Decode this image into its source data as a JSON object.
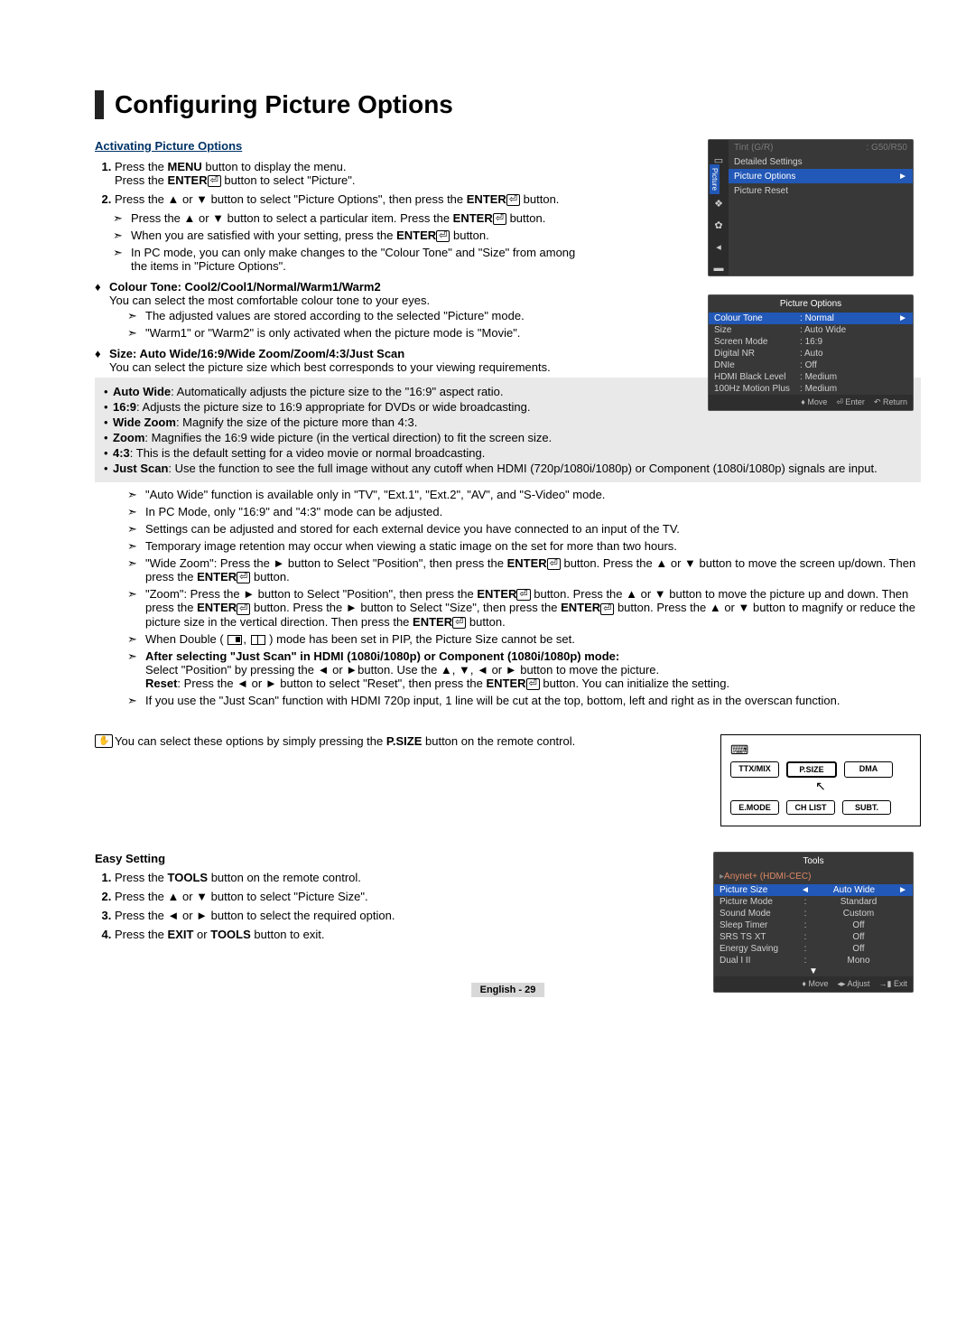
{
  "title": "Configuring Picture Options",
  "headings": {
    "activating": "Activating Picture Options",
    "easy": "Easy Setting"
  },
  "steps": {
    "s1a": "Press the ",
    "s1a_bold": "MENU",
    "s1a_cont": " button to display the menu.",
    "s1b": "Press the ",
    "s1b_bold": "ENTER",
    "s1b_cont": " button to select \"Picture\".",
    "s2": "Press the ▲ or ▼ button to select \"Picture Options\", then press the ",
    "s2_bold": "ENTER",
    "s2_cont": " button."
  },
  "notes1": {
    "n1": "Press the ▲ or ▼ button to select a particular item. Press the ",
    "n1_bold": "ENTER",
    "n1_cont": " button.",
    "n2": "When you are satisfied with your setting, press the ",
    "n2_bold": "ENTER",
    "n2_cont": " button.",
    "n3": "In PC mode, you can only make changes to the \"Colour Tone\" and \"Size\" from among the items in \"Picture Options\"."
  },
  "colour": {
    "title": "Colour Tone: Cool2/Cool1/Normal/Warm1/Warm2",
    "desc": "You can select the most comfortable colour tone to your eyes.",
    "n1": "The adjusted values are stored according to the selected \"Picture\" mode.",
    "n2": "\"Warm1\" or \"Warm2\" is only activated when the picture mode is \"Movie\"."
  },
  "size": {
    "title": "Size: Auto Wide/16:9/Wide Zoom/Zoom/4:3/Just Scan",
    "desc": "You can select the picture size which best corresponds to your viewing requirements.",
    "bullets": {
      "b1_label": "Auto Wide",
      "b1": ": Automatically adjusts the picture size to the \"16:9\" aspect ratio.",
      "b2_label": "16:9",
      "b2": ": Adjusts the picture size to 16:9 appropriate for DVDs or wide broadcasting.",
      "b3_label": "Wide Zoom",
      "b3": ": Magnify the size of the picture more than 4:3.",
      "b4_label": "Zoom",
      "b4": ": Magnifies the 16:9 wide picture (in the vertical direction) to fit the screen size.",
      "b5_label": "4:3",
      "b5": ": This is the default setting for a video movie or normal broadcasting.",
      "b6_label": "Just Scan",
      "b6": ": Use the function to see the full image without any cutoff when HDMI (720p/1080i/1080p) or Component (1080i/1080p) signals are input."
    },
    "notes": {
      "m1": "\"Auto Wide\" function is available only in \"TV\", \"Ext.1\", \"Ext.2\", \"AV\", and \"S-Video\" mode.",
      "m2": "In PC Mode, only \"16:9\" and \"4:3\" mode can be adjusted.",
      "m3": "Settings can be adjusted and stored for each external device you have connected to an input of the TV.",
      "m4": "Temporary image retention may occur when viewing a static image on the set for more than two hours.",
      "m5a": "\"Wide Zoom\": Press the ► button to Select \"Position\", then press the ",
      "m5a_bold": "ENTER",
      "m5a_cont": " button. Press the ▲ or ▼ button to move the screen up/down. Then press the ",
      "m5b_bold": "ENTER",
      "m5b_cont": " button.",
      "m6a": "\"Zoom\": Press the ► button to Select \"Position\", then press the ",
      "m6a_bold": "ENTER",
      "m6a_cont": " button. Press the ▲ or ▼ button to move the picture up and down. Then press the ",
      "m6b_bold": "ENTER",
      "m6b_cont": " button. Press the ► button to Select \"Size\", then press the ",
      "m6c_bold": "ENTER",
      "m6c_cont": " button. Press the ▲ or ▼ button to magnify or reduce the picture size in the vertical direction. Then press the ",
      "m6d_bold": "ENTER",
      "m6d_cont": " button.",
      "m7a": "When Double ( ",
      "m7b": " ) mode has been set in PIP, the Picture Size cannot be set.",
      "m8_bold": "After selecting \"Just Scan\" in HDMI (1080i/1080p) or Component (1080i/1080p) mode:",
      "m8a": "Select \"Position\" by pressing the ◄ or ►button. Use the ▲, ▼, ◄ or ► button to move the picture.",
      "m8b_label": "Reset",
      "m8b": ": Press the ◄ or ► button to select \"Reset\", then press the ",
      "m8b_bold": "ENTER",
      "m8b_cont": " button. You can initialize the setting.",
      "m9": "If you use the \"Just Scan\" function with HDMI 720p input, 1 line will be cut at the top, bottom, left and right as in the overscan function."
    }
  },
  "remote_note_a": "You can select these options by simply pressing the ",
  "remote_note_bold": "P.SIZE",
  "remote_note_b": " button on the remote control.",
  "easy": {
    "e1a": "Press the ",
    "e1_bold": "TOOLS",
    "e1b": " button on the remote control.",
    "e2": "Press the ▲ or ▼ button to select \"Picture Size\".",
    "e3": "Press the ◄ or ► button to select the required option.",
    "e4a": "Press the ",
    "e4_bold1": "EXIT",
    "e4_mid": " or ",
    "e4_bold2": "TOOLS",
    "e4b": " button to exit."
  },
  "remote_buttons": {
    "r1": "TTX/MIX",
    "r2": "P.SIZE",
    "r3": "DMA",
    "r4": "E.MODE",
    "r5": "CH LIST",
    "r6": "SUBT."
  },
  "osd1": {
    "tint_k": "Tint (G/R)",
    "tint_v": "G50/R50",
    "detailed": "Detailed Settings",
    "selected": "Picture Options",
    "reset": "Picture Reset",
    "tab": "Picture"
  },
  "osd2": {
    "title": "Picture Options",
    "rows": [
      {
        "k": "Colour Tone",
        "v": "Normal",
        "sel": true
      },
      {
        "k": "Size",
        "v": "Auto Wide"
      },
      {
        "k": "Screen Mode",
        "v": "16:9",
        "dim": true
      },
      {
        "k": "Digital NR",
        "v": "Auto"
      },
      {
        "k": "DNIe",
        "v": "Off",
        "dim": true
      },
      {
        "k": "HDMI Black Level",
        "v": "Medium",
        "dim": true
      },
      {
        "k": "100Hz Motion Plus",
        "v": "Medium"
      }
    ],
    "footer": {
      "a": "Move",
      "b": "Enter",
      "c": "Return"
    }
  },
  "tools": {
    "title": "Tools",
    "anynet": "Anynet+ (HDMI-CEC)",
    "rows": [
      {
        "k": "Picture Size",
        "v": "Auto Wide",
        "sel": true
      },
      {
        "k": "Picture Mode",
        "v": "Standard"
      },
      {
        "k": "Sound Mode",
        "v": "Custom"
      },
      {
        "k": "Sleep Timer",
        "v": "Off"
      },
      {
        "k": "SRS TS XT",
        "v": "Off"
      },
      {
        "k": "Energy Saving",
        "v": "Off"
      },
      {
        "k": "Dual I II",
        "v": "Mono"
      }
    ],
    "footer": {
      "a": "Move",
      "b": "Adjust",
      "c": "Exit"
    }
  },
  "page_number": "English - 29"
}
